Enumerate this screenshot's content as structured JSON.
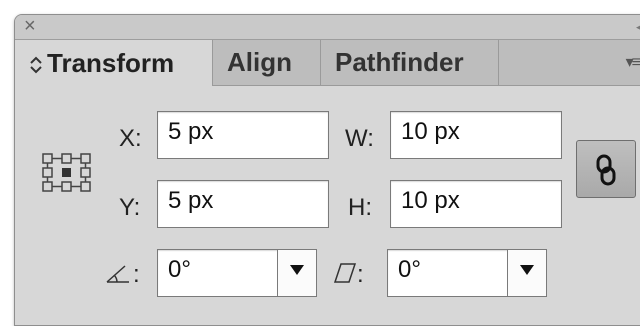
{
  "window": {
    "close_icon": "close-icon",
    "collapse_icon": "double-chevron-left-icon"
  },
  "tabs": [
    {
      "label": "Transform",
      "active": true
    },
    {
      "label": "Align",
      "active": false
    },
    {
      "label": "Pathfinder",
      "active": false
    }
  ],
  "panel_menu_icon": "panel-menu-icon",
  "fields": {
    "x": {
      "label": "X:",
      "value": "5 px"
    },
    "y": {
      "label": "Y:",
      "value": "5 px"
    },
    "w": {
      "label": "W:",
      "value": "10 px"
    },
    "h": {
      "label": "H:",
      "value": "10 px"
    }
  },
  "rotate": {
    "label": ":",
    "value": "0°",
    "icon": "rotate-angle-icon"
  },
  "shear": {
    "label": ":",
    "value": "0°",
    "icon": "shear-icon"
  },
  "reference_point_icon": "reference-point-locator-icon",
  "constrain_icon": "chain-link-icon",
  "colors": {
    "panel_bg": "#d7d7d7",
    "tabbar_bg": "#bdbdbd",
    "field_bg": "#ffffff"
  }
}
